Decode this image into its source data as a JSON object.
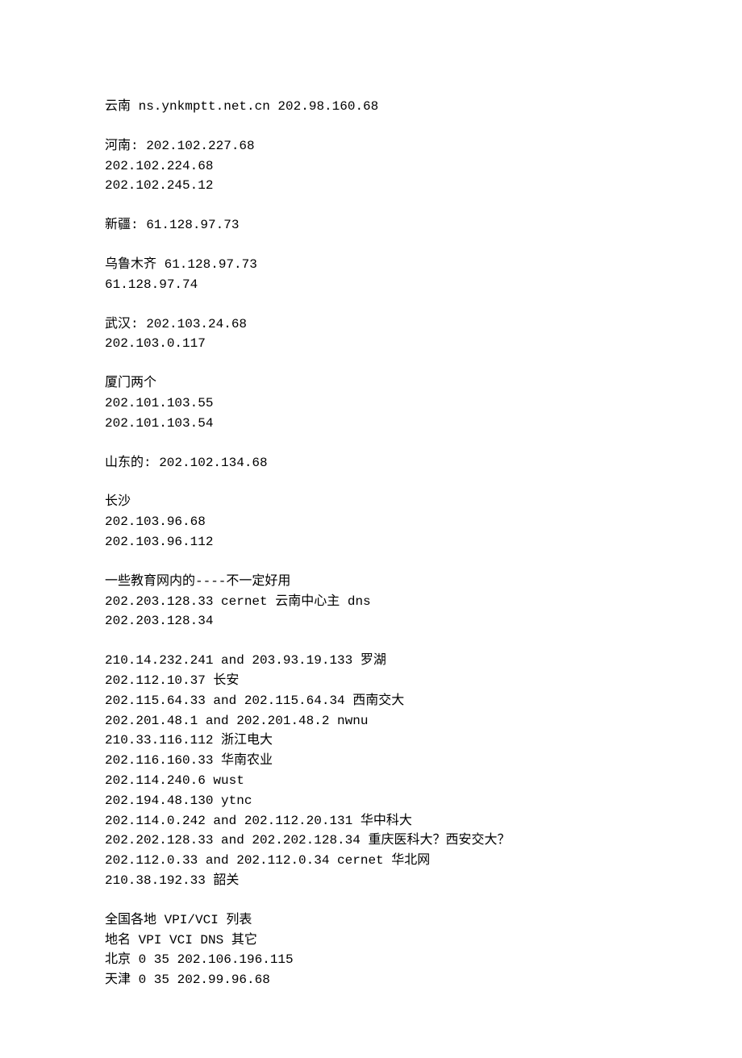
{
  "blocks": [
    {
      "lines": [
        "云南 ns.ynkmptt.net.cn 202.98.160.68"
      ]
    },
    {
      "lines": [
        "河南: 202.102.227.68",
        "202.102.224.68",
        "202.102.245.12"
      ]
    },
    {
      "lines": [
        "新疆: 61.128.97.73"
      ]
    },
    {
      "lines": [
        "乌鲁木齐 61.128.97.73",
        "61.128.97.74"
      ]
    },
    {
      "lines": [
        "武汉: 202.103.24.68",
        "202.103.0.117"
      ]
    },
    {
      "lines": [
        "厦门两个",
        "202.101.103.55",
        "202.101.103.54"
      ]
    },
    {
      "lines": [
        "山东的: 202.102.134.68"
      ]
    },
    {
      "lines": [
        "长沙",
        "202.103.96.68",
        "202.103.96.112"
      ]
    },
    {
      "lines": [
        "一些教育网内的----不一定好用",
        "202.203.128.33 cernet 云南中心主 dns",
        "202.203.128.34"
      ]
    },
    {
      "lines": [
        "210.14.232.241 and 203.93.19.133 罗湖",
        "202.112.10.37 长安",
        "202.115.64.33 and 202.115.64.34 西南交大",
        "202.201.48.1 and 202.201.48.2 nwnu",
        "210.33.116.112 浙江电大",
        "202.116.160.33 华南农业",
        "202.114.240.6 wust",
        "202.194.48.130 ytnc",
        "202.114.0.242 and 202.112.20.131 华中科大",
        "202.202.128.33 and 202.202.128.34 重庆医科大？西安交大？",
        "202.112.0.33 and 202.112.0.34 cernet 华北网",
        "210.38.192.33 韶关"
      ]
    },
    {
      "lines": [
        "全国各地 VPI/VCI 列表",
        "地名 VPI VCI DNS 其它",
        "北京 0 35 202.106.196.115",
        "天津 0 35 202.99.96.68"
      ]
    }
  ]
}
